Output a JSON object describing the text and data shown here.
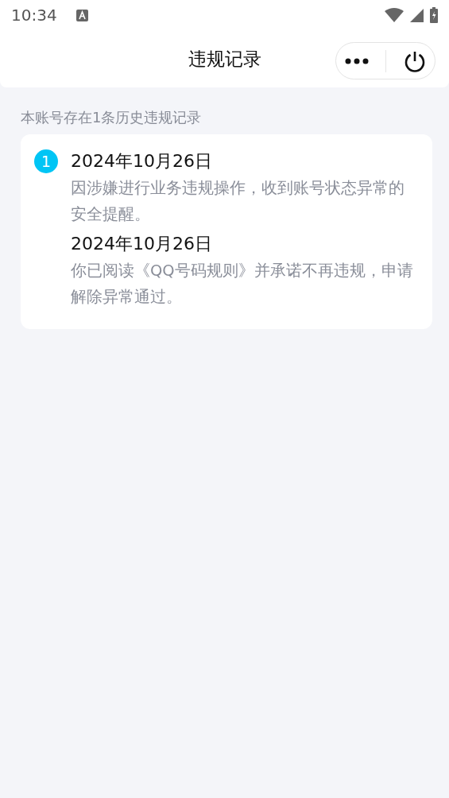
{
  "status_bar": {
    "time": "10:34"
  },
  "nav": {
    "title": "违规记录"
  },
  "summary": "本账号存在1条历史违规记录",
  "records": [
    {
      "number": "1",
      "events": [
        {
          "date": "2024年10月26日",
          "text": "因涉嫌进行业务违规操作，收到账号状态异常的安全提醒。"
        },
        {
          "date": "2024年10月26日",
          "text": "你已阅读《QQ号码规则》并承诺不再违规，申请解除异常通过。"
        }
      ]
    }
  ]
}
